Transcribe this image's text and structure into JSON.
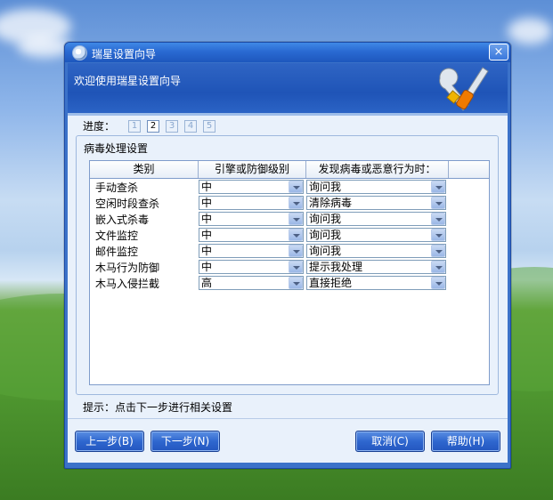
{
  "window": {
    "title": "瑞星设置向导",
    "close_label": "×",
    "banner_text": "欢迎使用瑞星设置向导"
  },
  "progress": {
    "label": "进度：",
    "steps": [
      "1",
      "2",
      "3",
      "4",
      "5"
    ],
    "current": 2
  },
  "group": {
    "title": "病毒处理设置"
  },
  "table": {
    "headers": [
      "类别",
      "引擎或防御级别",
      "发现病毒或恶意行为时："
    ],
    "rows": [
      {
        "category": "手动查杀",
        "level": "中",
        "action": "询问我"
      },
      {
        "category": "空闲时段查杀",
        "level": "中",
        "action": "清除病毒"
      },
      {
        "category": "嵌入式杀毒",
        "level": "中",
        "action": "询问我"
      },
      {
        "category": "文件监控",
        "level": "中",
        "action": "询问我"
      },
      {
        "category": "邮件监控",
        "level": "中",
        "action": "询问我"
      },
      {
        "category": "木马行为防御",
        "level": "中",
        "action": "提示我处理"
      },
      {
        "category": "木马入侵拦截",
        "level": "高",
        "action": "直接拒绝"
      }
    ]
  },
  "hint": "提示：点击下一步进行相关设置",
  "buttons": {
    "prev": "上一步(B)",
    "next": "下一步(N)",
    "cancel": "取消(C)",
    "help": "帮助(H)"
  },
  "icons": {
    "title": "shield-icon",
    "banner": "wrench-screwdriver-icon",
    "combo": "chevron-down-icon"
  }
}
